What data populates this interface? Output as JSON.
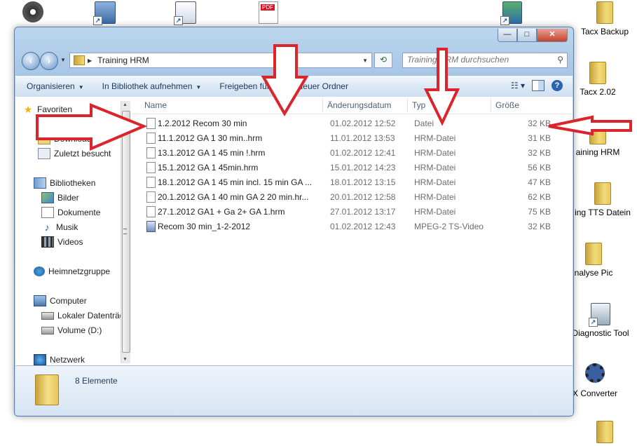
{
  "desktop": {
    "icons": [
      {
        "label": "Tacx Backup",
        "kind": "folder"
      },
      {
        "label": "Tacx 2.02",
        "kind": "folder"
      },
      {
        "label": "aining HRM",
        "kind": "folder"
      },
      {
        "label": "ing TTS Datein",
        "kind": "folder"
      },
      {
        "label": "nalyse Pic",
        "kind": "folder"
      },
      {
        "label": "Diagnostic Tool",
        "kind": "shortcut"
      },
      {
        "label": "X Converter",
        "kind": "shortcut"
      }
    ]
  },
  "window": {
    "address": {
      "path": "Training HRM",
      "search_placeholder": "Training HRM durchsuchen"
    },
    "toolbar": {
      "organize": "Organisieren",
      "include_library": "In Bibliothek aufnehmen",
      "share": "Freigeben für",
      "new_folder": "Neuer Ordner"
    },
    "nav": {
      "favorites": "Favoriten",
      "desktop": "Desktop",
      "downloads": "Downloads",
      "recent": "Zuletzt besucht",
      "libraries": "Bibliotheken",
      "pictures": "Bilder",
      "documents": "Dokumente",
      "music": "Musik",
      "videos": "Videos",
      "homegroup": "Heimnetzgruppe",
      "computer": "Computer",
      "local_drive": "Lokaler Datenträg",
      "volume_d": "Volume (D:)",
      "network": "Netzwerk"
    },
    "columns": {
      "name": "Name",
      "modified": "Änderungsdatum",
      "type": "Typ",
      "size": "Größe"
    },
    "files": [
      {
        "name": "1.2.2012   Recom      30 min",
        "modified": "01.02.2012 12:52",
        "type": "Datei",
        "size": "32 KB"
      },
      {
        "name": "11.1.2012   GA 1 30 min..hrm",
        "modified": "11.01.2012 13:53",
        "type": "HRM-Datei",
        "size": "31 KB"
      },
      {
        "name": "13.1.2012   GA 1    45 min  !.hrm",
        "modified": "01.02.2012 12:41",
        "type": "HRM-Datei",
        "size": "32 KB"
      },
      {
        "name": "15.1.2012  GA 1  45min.hrm",
        "modified": "15.01.2012 14:23",
        "type": "HRM-Datei",
        "size": "56 KB"
      },
      {
        "name": "18.1.2012  GA 1    45 min incl. 15 min GA ...",
        "modified": "18.01.2012 13:15",
        "type": "HRM-Datei",
        "size": "47 KB"
      },
      {
        "name": "20.1.2012  GA 1  40 min   GA 2   20 min.hr...",
        "modified": "20.01.2012 12:58",
        "type": "HRM-Datei",
        "size": "62 KB"
      },
      {
        "name": "27.1.2012 GA1 + Ga 2+ GA 1.hrm",
        "modified": "27.01.2012 13:17",
        "type": "HRM-Datei",
        "size": "75 KB"
      },
      {
        "name": "Recom 30 min_1-2-2012",
        "modified": "01.02.2012 12:43",
        "type": "MPEG-2 TS-Video",
        "size": "32 KB"
      }
    ],
    "details": {
      "count": "8 Elemente"
    }
  },
  "colors": {
    "annotation_red": "#d9252b",
    "selection_blue": "#cce8ff"
  }
}
